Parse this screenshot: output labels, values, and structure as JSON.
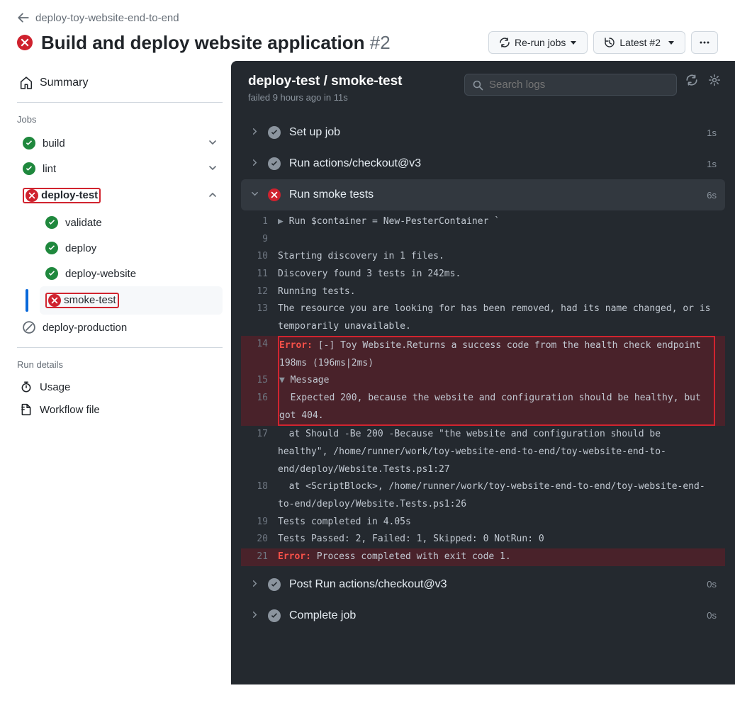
{
  "breadcrumb": {
    "workflow_name": "deploy-toy-website-end-to-end"
  },
  "title": {
    "text": "Build and deploy website application",
    "run_number": "#2"
  },
  "buttons": {
    "rerun": "Re-run jobs",
    "latest": "Latest #2"
  },
  "sidebar": {
    "summary": "Summary",
    "jobs_label": "Jobs",
    "run_details_label": "Run details",
    "usage": "Usage",
    "workflow_file": "Workflow file",
    "jobs": [
      {
        "name": "build",
        "status": "success"
      },
      {
        "name": "lint",
        "status": "success"
      },
      {
        "name": "deploy-test",
        "status": "fail",
        "expanded": true,
        "children": [
          {
            "name": "validate",
            "status": "success"
          },
          {
            "name": "deploy",
            "status": "success"
          },
          {
            "name": "deploy-website",
            "status": "success"
          },
          {
            "name": "smoke-test",
            "status": "fail",
            "active": true
          }
        ]
      },
      {
        "name": "deploy-production",
        "status": "skipped"
      }
    ]
  },
  "log_header": {
    "title": "deploy-test / smoke-test",
    "subtitle": "failed 9 hours ago in 11s",
    "search_placeholder": "Search logs"
  },
  "steps": [
    {
      "title": "Set up job",
      "status": "success",
      "time": "1s",
      "expanded": false
    },
    {
      "title": "Run actions/checkout@v3",
      "status": "success",
      "time": "1s",
      "expanded": false
    },
    {
      "title": "Run smoke tests",
      "status": "fail",
      "time": "6s",
      "expanded": true
    },
    {
      "title": "Post Run actions/checkout@v3",
      "status": "success",
      "time": "0s",
      "expanded": false
    },
    {
      "title": "Complete job",
      "status": "success",
      "time": "0s",
      "expanded": false
    }
  ],
  "log_lines": {
    "l1": "Run $container = New-PesterContainer `",
    "l10": "Starting discovery in 1 files.",
    "l11": "Discovery found 3 tests in 242ms.",
    "l12": "Running tests.",
    "l13": "The resource you are looking for has been removed, had its name changed, or is temporarily unavailable.",
    "l14_err": "Error:",
    "l14": " [-] Toy Website.Returns a success code from the health check endpoint 198ms (196ms|2ms)",
    "l15": "Message",
    "l16": "  Expected 200, because the website and configuration should be healthy, but got 404.",
    "l17": "  at Should -Be 200 -Because \"the website and configuration should be healthy\", /home/runner/work/toy-website-end-to-end/toy-website-end-to-end/deploy/Website.Tests.ps1:27",
    "l18": "  at <ScriptBlock>, /home/runner/work/toy-website-end-to-end/toy-website-end-to-end/deploy/Website.Tests.ps1:26",
    "l19": "Tests completed in 4.05s",
    "l20": "Tests Passed: 2, Failed: 1, Skipped: 0 NotRun: 0",
    "l21_err": "Error:",
    "l21": " Process completed with exit code 1."
  }
}
